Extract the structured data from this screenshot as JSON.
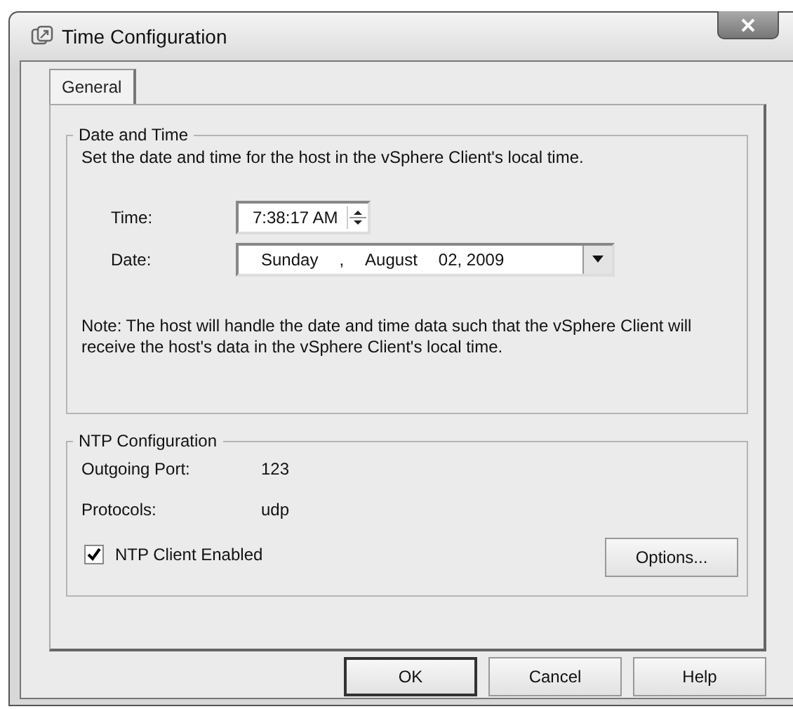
{
  "window": {
    "title": "Time Configuration"
  },
  "tabs": [
    {
      "label": "General",
      "selected": true
    }
  ],
  "date_time": {
    "legend": "Date and Time",
    "description": "Set the date and time for the host in the vSphere Client's local time.",
    "time": {
      "label": "Time:",
      "value": "7:38:17 AM"
    },
    "date": {
      "label": "Date:",
      "weekday": "Sunday",
      "separator": ",",
      "month": "August",
      "day_year": "02, 2009"
    },
    "note": "Note: The host will handle the date and time data such that the vSphere Client will receive the host's data in the vSphere Client's local time."
  },
  "ntp": {
    "legend": "NTP Configuration",
    "fields": [
      {
        "label": "Outgoing Port:",
        "value": "123"
      },
      {
        "label": "Protocols:",
        "value": "udp"
      }
    ],
    "client_enabled": {
      "label": "NTP Client Enabled",
      "checked": true
    },
    "options_button": "Options..."
  },
  "buttons": [
    {
      "label": "OK",
      "default": true
    },
    {
      "label": "Cancel",
      "default": false
    },
    {
      "label": "Help",
      "default": false
    }
  ]
}
